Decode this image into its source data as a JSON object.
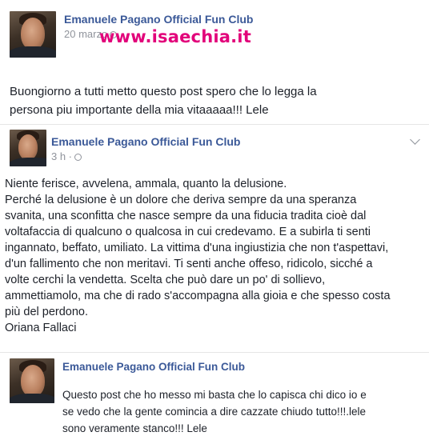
{
  "watermark": "www.isaechia.it",
  "posts": [
    {
      "author": "Emanuele Pagano Official Fun Club",
      "timestamp": "20 marzo",
      "body": "Buongiorno a tutti metto questo post spero che lo legga la\npersona piu importante della mia vitaaaaa!!! Lele"
    },
    {
      "author": "Emanuele Pagano Official Fun Club",
      "timestamp": "3 h ·",
      "body": "Niente ferisce, avvelena, ammala, quanto la delusione.\nPerché la delusione è un dolore che deriva sempre da una speranza\nsvanita, una sconfitta che nasce sempre da una fiducia tradita cioè dal\nvoltafaccia di qualcuno o qualcosa in cui credevamo. E a subirla ti senti\ningannato, beffato, umiliato. La vittima d'una ingiustizia che non t'aspettavi,\nd'un fallimento che non meritavi. Ti senti anche offeso, ridicolo, sicché a\nvolte cerchi la vendetta. Scelta che può dare un po' di sollievo,\nammettiamolo, ma che di rado s'accompagna alla gioia e che spesso costa\npiù del perdono.\nOriana Fallaci"
    },
    {
      "author": "Emanuele Pagano Official Fun Club",
      "timestamp": "",
      "body": "Questo post che ho messo mi basta che lo capisca chi dico io e\nse vedo che la gente comincia a dire cazzate chiudo tutto!!!.lele\nsono veramente stanco!!! Lele"
    }
  ],
  "icons": {
    "privacy": "globe-icon",
    "options": "chevron-down-icon"
  },
  "colors": {
    "author_link": "#3b5998",
    "meta_text": "#90949c",
    "watermark": "#e2007a"
  }
}
